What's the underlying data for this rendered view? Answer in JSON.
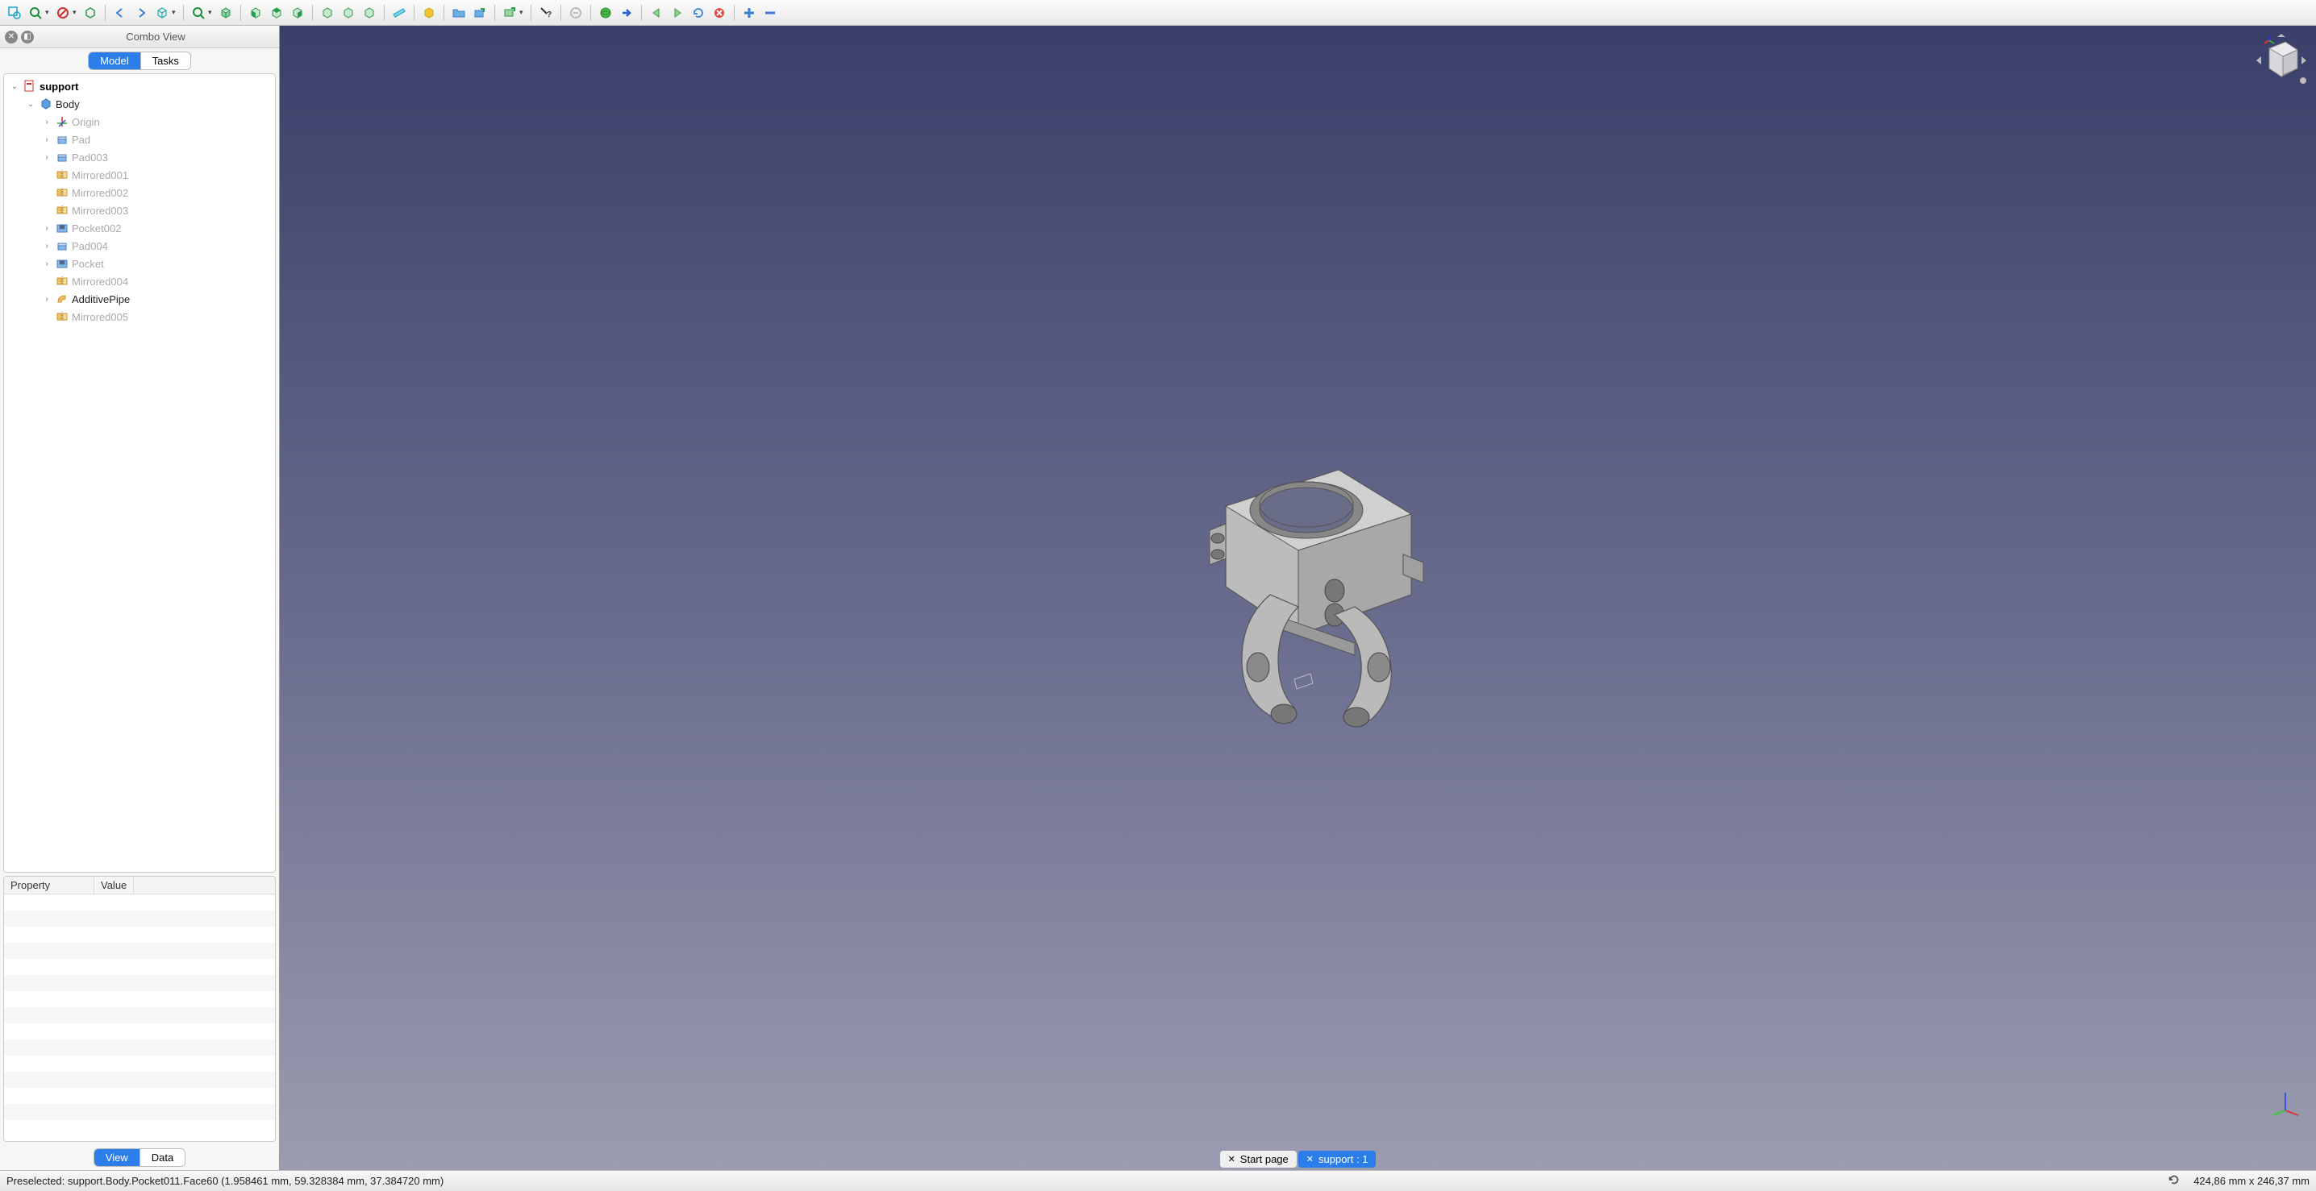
{
  "toolbar": {
    "icons": [
      "zoom-extents",
      "zoom-in",
      "zoom-out",
      "draw-style",
      "sep",
      "nav-back",
      "nav-forward",
      "view-group",
      "sep",
      "zoom-fit",
      "iso-view",
      "sep",
      "front-view",
      "top-view",
      "right-view",
      "sep",
      "rear-view",
      "bottom-view",
      "left-view",
      "sep",
      "measure",
      "sep",
      "part-tool",
      "sep",
      "folder",
      "export",
      "sep",
      "link",
      "sep",
      "whats-this",
      "sep",
      "stop",
      "sep",
      "web-home",
      "web-next",
      "sep",
      "nav-left",
      "nav-right",
      "reload",
      "close-tab",
      "sep",
      "plus",
      "minus"
    ]
  },
  "panel": {
    "title": "Combo View",
    "top_tabs": {
      "model": "Model",
      "tasks": "Tasks"
    },
    "bottom_tabs": {
      "view": "View",
      "data": "Data"
    }
  },
  "tree": {
    "root": {
      "label": "support"
    },
    "body": {
      "label": "Body"
    },
    "items": [
      {
        "label": "Origin",
        "icon": "origin",
        "dim": true,
        "exp": true
      },
      {
        "label": "Pad",
        "icon": "pad",
        "dim": true,
        "exp": true
      },
      {
        "label": "Pad003",
        "icon": "pad",
        "dim": true,
        "exp": true
      },
      {
        "label": "Mirrored001",
        "icon": "mirror",
        "dim": true,
        "exp": false
      },
      {
        "label": "Mirrored002",
        "icon": "mirror",
        "dim": true,
        "exp": false
      },
      {
        "label": "Mirrored003",
        "icon": "mirror",
        "dim": true,
        "exp": false
      },
      {
        "label": "Pocket002",
        "icon": "pocket",
        "dim": true,
        "exp": true
      },
      {
        "label": "Pad004",
        "icon": "pad",
        "dim": true,
        "exp": true
      },
      {
        "label": "Pocket",
        "icon": "pocket",
        "dim": true,
        "exp": true
      },
      {
        "label": "Mirrored004",
        "icon": "mirror",
        "dim": true,
        "exp": false
      },
      {
        "label": "AdditivePipe",
        "icon": "pipe",
        "dim": false,
        "exp": true
      },
      {
        "label": "Mirrored005",
        "icon": "mirror",
        "dim": true,
        "exp": false
      }
    ]
  },
  "property": {
    "col1": "Property",
    "col2": "Value"
  },
  "viewport_tabs": {
    "start": "Start page",
    "doc": "support : 1"
  },
  "status": {
    "preselected": "Preselected: support.Body.Pocket011.Face60 (1.958461 mm, 59.328384 mm, 37.384720 mm)",
    "dimensions": "424,86 mm x 246,37 mm"
  }
}
